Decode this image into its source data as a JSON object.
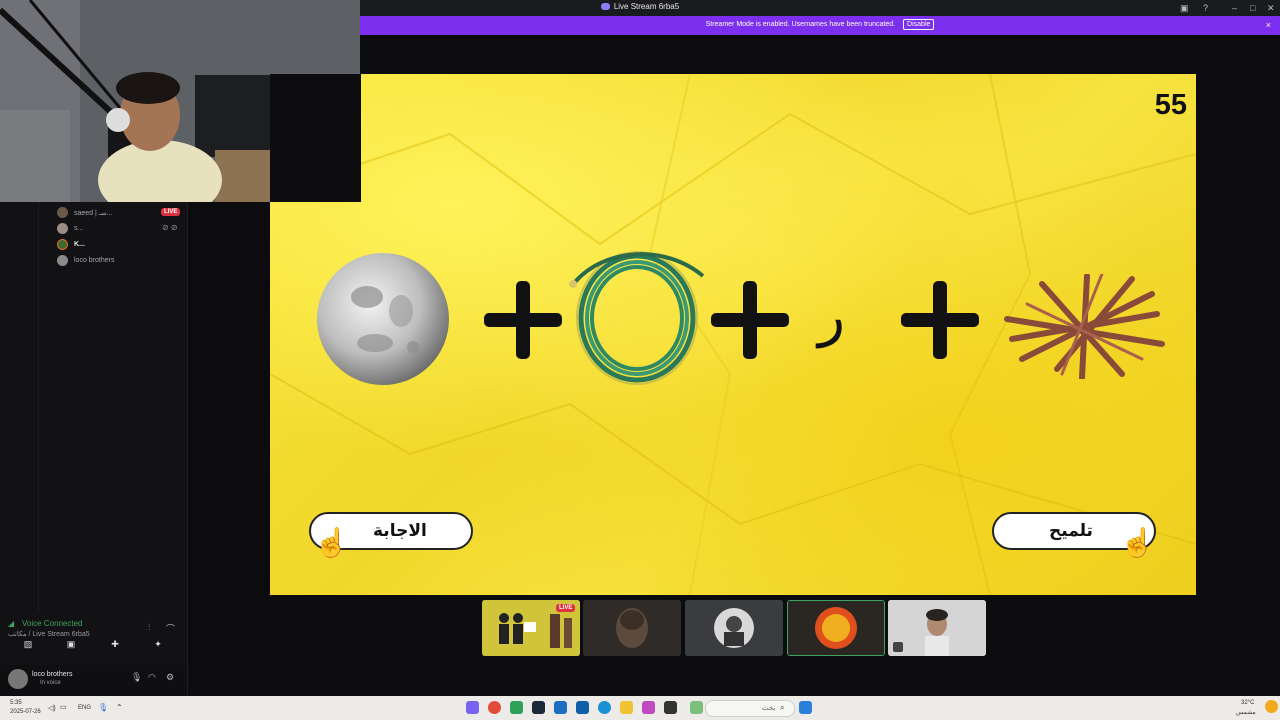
{
  "window": {
    "title": "Live Stream 6rba5",
    "controls": [
      "minimize",
      "maximize",
      "close"
    ]
  },
  "banner": {
    "message": "Streamer Mode is enabled. Usernames have been truncated.",
    "disable_label": "Disable",
    "close_icon": "×",
    "background": "#7d2ff0"
  },
  "voice_users": [
    {
      "name": "saeed | سـ...",
      "live": true
    },
    {
      "name": "s..."
    },
    {
      "name": "K..."
    },
    {
      "name": "loco brothers"
    }
  ],
  "live_badge": "LIVE",
  "voice_panel": {
    "status": "Voice Connected",
    "channel": "مكاتب / Live Stream 6rba5"
  },
  "user": {
    "name": "loco brothers",
    "status": "In voice"
  },
  "game": {
    "timer": "55",
    "letter": "ر",
    "answer_button": "الاجابة",
    "hint_button": "تلميح",
    "background": "#f4dd33"
  },
  "participants": {
    "live_badge": "LIVE"
  },
  "taskbar": {
    "time": "5:35",
    "date": "2025-07-26",
    "language": "ENG",
    "search_placeholder": "بحث",
    "weather": "32°C",
    "weather_sub": "مشمس"
  }
}
